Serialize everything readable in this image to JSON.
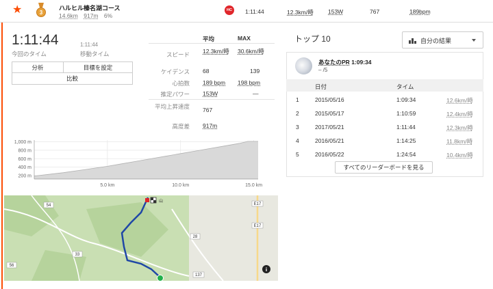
{
  "header": {
    "segment_name": "ハルヒル榛名湖コース",
    "distance": "14.6km",
    "elevation": "917m",
    "grade": "6%",
    "category_badge": "HC",
    "medal_rank": "3",
    "time": "1:11:44",
    "speed": "12.3km/時",
    "heartrate": "153W",
    "elev_gain": "767",
    "hr": "189bpm"
  },
  "summary": {
    "time": "1:11:44",
    "time_label": "今回のタイム",
    "moving_time": "1:11:44",
    "moving_time_label": "移動タイム",
    "buttons": {
      "analyze": "分析",
      "set_goal": "目標を設定",
      "compare": "比較"
    }
  },
  "stats": {
    "col_avg": "平均",
    "col_max": "MAX",
    "rows": [
      {
        "label": "スピード",
        "avg": "12.3km/時",
        "max": "30.6km/時"
      },
      {
        "label": "ケイデンス",
        "avg": "68",
        "max": "139"
      },
      {
        "label": "心拍数",
        "avg": "189 bpm",
        "max": "198 bpm"
      },
      {
        "label": "推定パワー",
        "avg": "153W",
        "max": "—"
      },
      {
        "label": "平均上昇速度",
        "avg": "767",
        "max": ""
      },
      {
        "label": "高度差",
        "avg": "917m",
        "max": ""
      }
    ]
  },
  "chart_data": {
    "type": "area",
    "title": "",
    "xlabel": "",
    "ylabel": "",
    "x_ticks": [
      "5.0 km",
      "10.0 km",
      "15.0 km"
    ],
    "y_ticks": [
      "1,000 m",
      "800 m",
      "600 m",
      "400 m",
      "200 m"
    ],
    "xlim": [
      0,
      15.3
    ],
    "ylim": [
      120,
      1040
    ],
    "x": [
      0,
      1,
      2,
      3,
      4,
      5,
      6,
      7,
      8,
      9,
      10,
      11,
      12,
      13,
      14,
      14.6,
      15.3
    ],
    "y": [
      190,
      230,
      270,
      320,
      370,
      420,
      480,
      540,
      600,
      660,
      720,
      780,
      840,
      900,
      960,
      1010,
      1010
    ],
    "colors": {
      "fill": "#d9d9d9",
      "line": "#b0b0b0",
      "grid": "#e6e6e6"
    }
  },
  "map": {
    "road_labels": [
      "54",
      "33",
      "56",
      "E17",
      "28",
      "137",
      "E17",
      "山"
    ],
    "info_icon": "info-icon",
    "colors": {
      "route": "#1f47a6",
      "start": "#21b04b",
      "land": "#c9dfb3",
      "land_dark": "#b6d39c",
      "road": "#ffffff"
    }
  },
  "leaderboard": {
    "title": "トップ 10",
    "dropdown_label": "自分の結果",
    "pr_title": "あなたのPR",
    "pr_time": "1:09:34",
    "pr_rank": "– /5",
    "col_date": "日付",
    "col_time": "タイム",
    "rows": [
      {
        "rank": "1",
        "date": "2015/05/16",
        "time": "1:09:34",
        "speed": "12.6km/時"
      },
      {
        "rank": "2",
        "date": "2015/05/17",
        "time": "1:10:59",
        "speed": "12.4km/時"
      },
      {
        "rank": "3",
        "date": "2017/05/21",
        "time": "1:11:44",
        "speed": "12.3km/時"
      },
      {
        "rank": "4",
        "date": "2016/05/21",
        "time": "1:14:25",
        "speed": "11.8km/時"
      },
      {
        "rank": "5",
        "date": "2016/05/22",
        "time": "1:24:54",
        "speed": "10.4km/時"
      }
    ],
    "see_all": "すべてのリーダーボードを見る"
  }
}
